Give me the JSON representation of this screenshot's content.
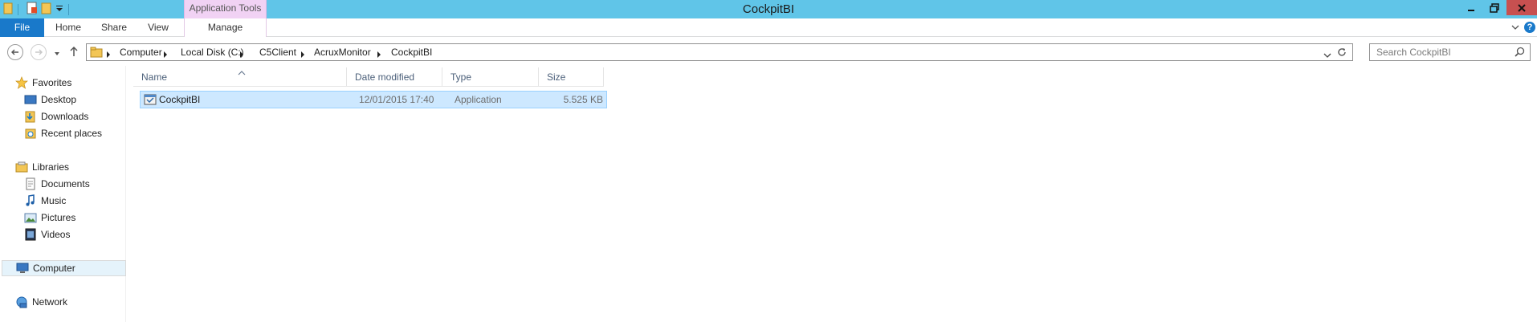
{
  "window": {
    "title": "CockpitBI",
    "contextual_tab_group": "Application Tools"
  },
  "ribbon": {
    "tabs": [
      "File",
      "Home",
      "Share",
      "View",
      "Manage"
    ]
  },
  "address": {
    "breadcrumbs": [
      "Computer",
      "Local Disk (C:)",
      "C5Client",
      "AcruxMonitor",
      "CockpitBI"
    ]
  },
  "search": {
    "placeholder": "Search CockpitBI"
  },
  "navigation": {
    "favorites": {
      "label": "Favorites",
      "items": [
        "Desktop",
        "Downloads",
        "Recent places"
      ]
    },
    "libraries": {
      "label": "Libraries",
      "items": [
        "Documents",
        "Music",
        "Pictures",
        "Videos"
      ]
    },
    "computer": "Computer",
    "network": "Network"
  },
  "file_list": {
    "columns": [
      "Name",
      "Date modified",
      "Type",
      "Size"
    ],
    "rows": [
      {
        "name": "CockpitBI",
        "date_modified": "12/01/2015 17:40",
        "type": "Application",
        "size": "5.525 KB"
      }
    ]
  },
  "colors": {
    "titlebar": "#60c5e8",
    "file_tab": "#1979ca",
    "contextual_tab": "#f1d2f4",
    "selection": "#cde8ff",
    "close_button": "#c75050"
  }
}
